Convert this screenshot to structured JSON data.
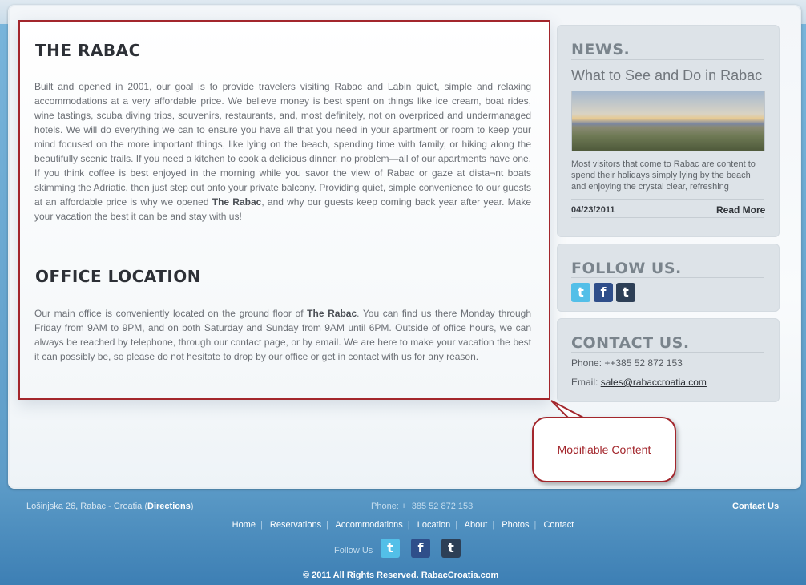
{
  "main": {
    "section1_title": "THE RABAC",
    "section1_text_a": "Built and opened in 2001, our goal is to provide travelers visiting Rabac and Labin quiet, simple and relaxing accommodations at a very affordable price. We believe money is best spent on things like ice cream, boat rides, wine tastings, scuba diving trips, souvenirs, restaurants, and, most definitely, not on overpriced and undermanaged hotels. We will do everything we can to ensure you have all that you need in your apartment or room to keep your mind focused on the more important things, like lying on the beach, spending time with family, or hiking along the beautifully scenic trails. If you need a kitchen to cook a delicious dinner, no problem—all of our apartments have one. If you think coffee is best enjoyed in the morning while you savor the view of Rabac or gaze at dista¬nt boats skimming the Adriatic, then just step out onto your private balcony. Providing quiet, simple convenience to our guests at an affordable price is why we opened ",
    "section1_bold": "The Rabac",
    "section1_text_b": ", and why our guests keep coming back year after year. Make your vacation the best it can be and stay with us!",
    "section2_title": "OFFICE LOCATION",
    "section2_text_a": "Our main office is conveniently located on the ground floor of ",
    "section2_bold": "The Rabac",
    "section2_text_b": ". You can find us there Monday through Friday from 9AM to 9PM, and on both Saturday and Sunday from 9AM until 6PM. Outside of office hours, we can always be reached by telephone, through our contact page, or by email. We are here to make your vacation the best it can possibly be, so please do not hesitate to drop by our office or get in contact with us for any reason."
  },
  "sidebar": {
    "news_heading": "NEWS.",
    "news_title": "What to See and Do in Rabac",
    "news_excerpt": "Most visitors that come to Rabac are content to spend their holidays simply lying by the beach and enjoying the crystal clear, refreshing",
    "news_date": "04/23/2011",
    "news_more": "Read More",
    "follow_heading": "FOLLOW US.",
    "contact_heading": "CONTACT US.",
    "phone_line": "Phone: ++385 52 872 153",
    "email_label": "Email: ",
    "email_value": "sales@rabaccroatia.com",
    "icons": [
      "twitter-icon",
      "facebook-icon",
      "tumblr-icon"
    ]
  },
  "callout": {
    "label": "Modifiable Content"
  },
  "footer": {
    "address": "Lošinjska 26, Rabac - Croatia (",
    "directions": "Directions",
    "address_close": ")",
    "phone": "Phone: ++385 52 872 153",
    "contact_link": "Contact Us",
    "nav": [
      "Home",
      "Reservations",
      "Accommodations",
      "Location",
      "About",
      "Photos",
      "Contact"
    ],
    "follow_label": "Follow Us",
    "copyright": "© 2011 All Rights Reserved. RabacCroatia.com"
  },
  "colors": {
    "accent_red": "#a3262c",
    "twitter": "#53bfe8",
    "facebook": "#2f4e8a",
    "tumblr": "#2d3f56"
  }
}
